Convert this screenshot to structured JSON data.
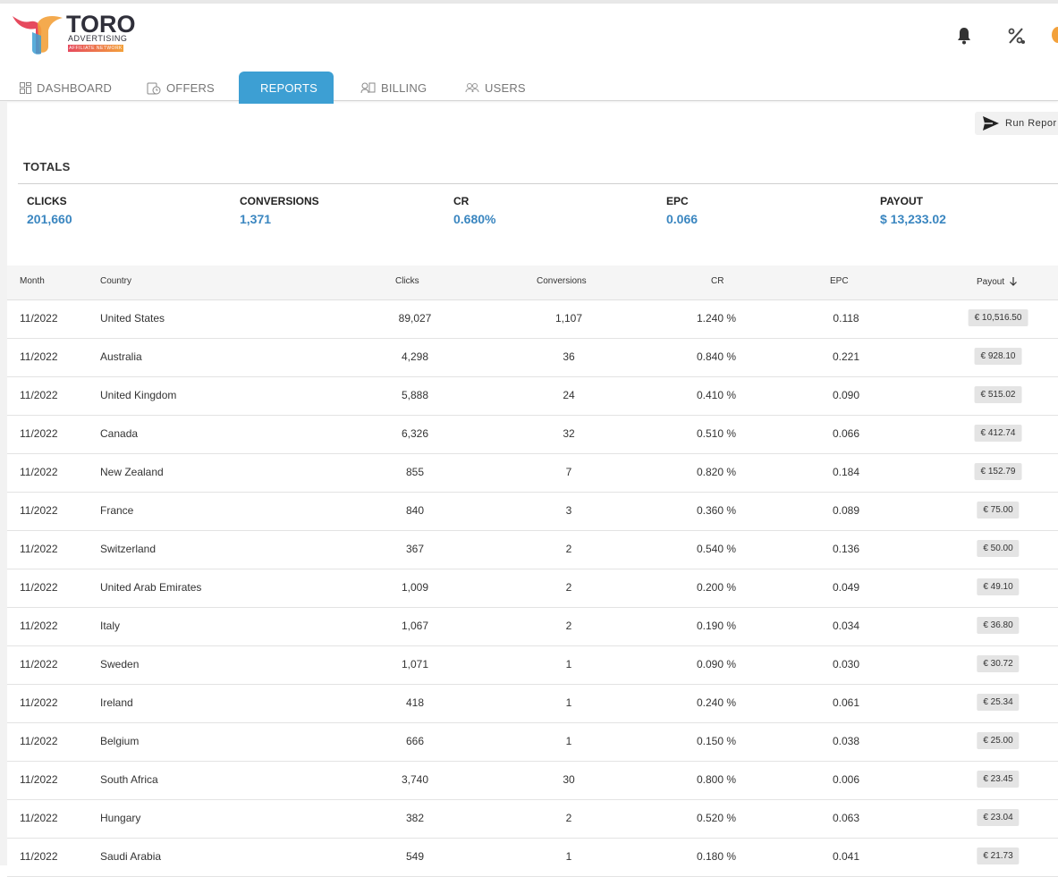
{
  "brand": {
    "title": "TORO",
    "subtitle": "ADVERTISING",
    "tagline": "AFFILIATE NETWORK"
  },
  "header_icons": [
    "bell-icon",
    "percent-settings-icon"
  ],
  "nav": {
    "tabs": [
      {
        "label": "DASHBOARD",
        "icon": "grid-icon",
        "active": false
      },
      {
        "label": "OFFERS",
        "icon": "clock-tag-icon",
        "active": false
      },
      {
        "label": "REPORTS",
        "icon": "trend-icon",
        "active": true
      },
      {
        "label": "BILLING",
        "icon": "billing-icon",
        "active": false
      },
      {
        "label": "USERS",
        "icon": "users-icon",
        "active": false
      }
    ]
  },
  "toolbar": {
    "run_report_label": "Run Repor"
  },
  "totals": {
    "title": "TOTALS",
    "items": [
      {
        "label": "CLICKS",
        "value": "201,660"
      },
      {
        "label": "CONVERSIONS",
        "value": "1,371"
      },
      {
        "label": "CR",
        "value": "0.680%"
      },
      {
        "label": "EPC",
        "value": "0.066"
      },
      {
        "label": "PAYOUT",
        "value": "$ 13,233.02"
      }
    ]
  },
  "table": {
    "columns": [
      "Month",
      "Country",
      "Clicks",
      "Conversions",
      "CR",
      "EPC",
      "Payout"
    ],
    "sort_icon": "arrow-down-icon",
    "rows": [
      {
        "month": "11/2022",
        "country": "United States",
        "clicks": "89,027",
        "conversions": "1,107",
        "cr": "1.240 %",
        "epc": "0.118",
        "payout": "€ 10,516.50"
      },
      {
        "month": "11/2022",
        "country": "Australia",
        "clicks": "4,298",
        "conversions": "36",
        "cr": "0.840 %",
        "epc": "0.221",
        "payout": "€ 928.10"
      },
      {
        "month": "11/2022",
        "country": "United Kingdom",
        "clicks": "5,888",
        "conversions": "24",
        "cr": "0.410 %",
        "epc": "0.090",
        "payout": "€ 515.02"
      },
      {
        "month": "11/2022",
        "country": "Canada",
        "clicks": "6,326",
        "conversions": "32",
        "cr": "0.510 %",
        "epc": "0.066",
        "payout": "€ 412.74"
      },
      {
        "month": "11/2022",
        "country": "New Zealand",
        "clicks": "855",
        "conversions": "7",
        "cr": "0.820 %",
        "epc": "0.184",
        "payout": "€ 152.79"
      },
      {
        "month": "11/2022",
        "country": "France",
        "clicks": "840",
        "conversions": "3",
        "cr": "0.360 %",
        "epc": "0.089",
        "payout": "€ 75.00"
      },
      {
        "month": "11/2022",
        "country": "Switzerland",
        "clicks": "367",
        "conversions": "2",
        "cr": "0.540 %",
        "epc": "0.136",
        "payout": "€ 50.00"
      },
      {
        "month": "11/2022",
        "country": "United Arab Emirates",
        "clicks": "1,009",
        "conversions": "2",
        "cr": "0.200 %",
        "epc": "0.049",
        "payout": "€ 49.10"
      },
      {
        "month": "11/2022",
        "country": "Italy",
        "clicks": "1,067",
        "conversions": "2",
        "cr": "0.190 %",
        "epc": "0.034",
        "payout": "€ 36.80"
      },
      {
        "month": "11/2022",
        "country": "Sweden",
        "clicks": "1,071",
        "conversions": "1",
        "cr": "0.090 %",
        "epc": "0.030",
        "payout": "€ 30.72"
      },
      {
        "month": "11/2022",
        "country": "Ireland",
        "clicks": "418",
        "conversions": "1",
        "cr": "0.240 %",
        "epc": "0.061",
        "payout": "€ 25.34"
      },
      {
        "month": "11/2022",
        "country": "Belgium",
        "clicks": "666",
        "conversions": "1",
        "cr": "0.150 %",
        "epc": "0.038",
        "payout": "€ 25.00"
      },
      {
        "month": "11/2022",
        "country": "South Africa",
        "clicks": "3,740",
        "conversions": "30",
        "cr": "0.800 %",
        "epc": "0.006",
        "payout": "€ 23.45"
      },
      {
        "month": "11/2022",
        "country": "Hungary",
        "clicks": "382",
        "conversions": "2",
        "cr": "0.520 %",
        "epc": "0.063",
        "payout": "€ 23.04"
      },
      {
        "month": "11/2022",
        "country": "Saudi Arabia",
        "clicks": "549",
        "conversions": "1",
        "cr": "0.180 %",
        "epc": "0.041",
        "payout": "€ 21.73"
      }
    ]
  },
  "colors": {
    "accent": "#3d9fd3",
    "value_blue": "#3a86c0",
    "brand_red": "#e64a5e",
    "brand_orange": "#f3a13b"
  }
}
